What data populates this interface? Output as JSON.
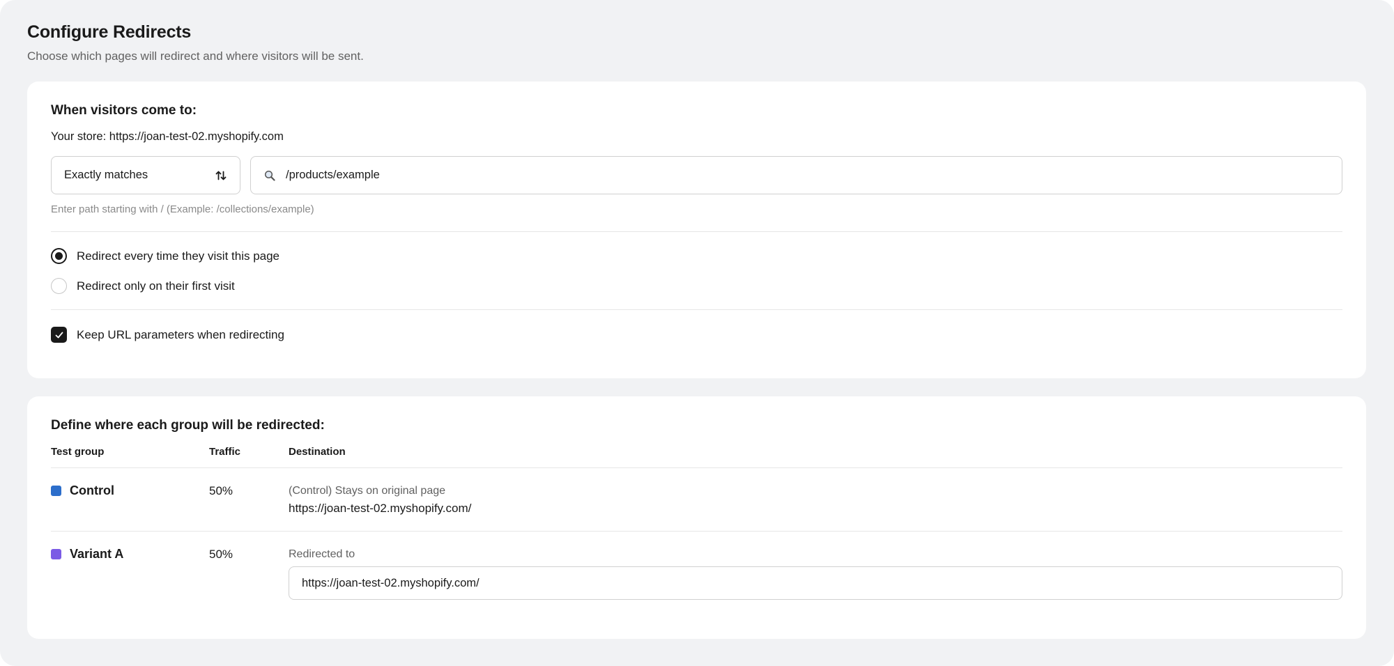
{
  "header": {
    "title": "Configure Redirects",
    "subtitle": "Choose which pages will redirect and where visitors will be sent."
  },
  "source": {
    "heading": "When visitors come to:",
    "store_line": "Your store: https://joan-test-02.myshopify.com",
    "match_select": {
      "value": "Exactly matches",
      "icon": "sort-arrows-icon"
    },
    "path_input": {
      "value": "/products/example",
      "icon": "search-icon"
    },
    "help_text": "Enter path starting with / (Example: /collections/example)",
    "redirect_options": [
      {
        "label": "Redirect every time they visit this page",
        "checked": true
      },
      {
        "label": "Redirect only on their first visit",
        "checked": false
      }
    ],
    "keep_params": {
      "label": "Keep URL parameters when redirecting",
      "checked": true
    }
  },
  "destinations": {
    "heading": "Define where each group will be redirected:",
    "columns": [
      "Test group",
      "Traffic",
      "Destination"
    ],
    "groups": [
      {
        "name": "Control",
        "color": "#2c6ecb",
        "traffic": "50%",
        "caption": "(Control) Stays on original page",
        "url": "https://joan-test-02.myshopify.com/"
      },
      {
        "name": "Variant A",
        "color": "#7b5be5",
        "traffic": "50%",
        "caption": "Redirected to",
        "url": "https://joan-test-02.myshopify.com/"
      }
    ]
  }
}
